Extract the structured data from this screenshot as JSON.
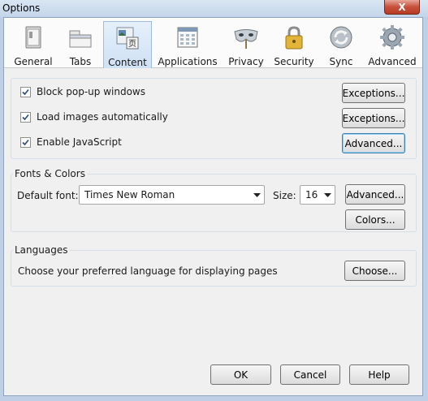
{
  "window": {
    "title": "Options",
    "close_glyph": "X"
  },
  "panes": [
    {
      "label": "General",
      "icon": "general-window-icon"
    },
    {
      "label": "Tabs",
      "icon": "tabs-folder-icon"
    },
    {
      "label": "Content",
      "icon": "content-page-icon",
      "selected": true
    },
    {
      "label": "Applications",
      "icon": "applications-calendar-icon"
    },
    {
      "label": "Privacy",
      "icon": "privacy-mask-icon"
    },
    {
      "label": "Security",
      "icon": "security-lock-icon"
    },
    {
      "label": "Sync",
      "icon": "sync-arrows-icon"
    },
    {
      "label": "Advanced",
      "icon": "advanced-gear-icon"
    }
  ],
  "content_icon_glyph": "页",
  "general": {
    "block_popups": {
      "label": "Block pop-up windows",
      "checked": true
    },
    "load_images": {
      "label": "Load images automatically",
      "checked": true
    },
    "enable_js": {
      "label": "Enable JavaScript",
      "checked": true
    },
    "exceptions_label": "Exceptions...",
    "advanced_label": "Advanced..."
  },
  "fonts": {
    "title": "Fonts & Colors",
    "default_font_label": "Default font:",
    "default_font_value": "Times New Roman",
    "size_label": "Size:",
    "size_value": "16",
    "advanced_label": "Advanced...",
    "colors_label": "Colors..."
  },
  "languages": {
    "title": "Languages",
    "description": "Choose your preferred language for displaying pages",
    "choose_label": "Choose..."
  },
  "footer": {
    "ok_label": "OK",
    "cancel_label": "Cancel",
    "help_label": "Help"
  },
  "colors": {
    "selected_tab_bg": "#cfe1f5",
    "dialog_bg": "#f0f0f0",
    "titlebar": "#c3d5ea",
    "close_red": "#c7503a"
  }
}
